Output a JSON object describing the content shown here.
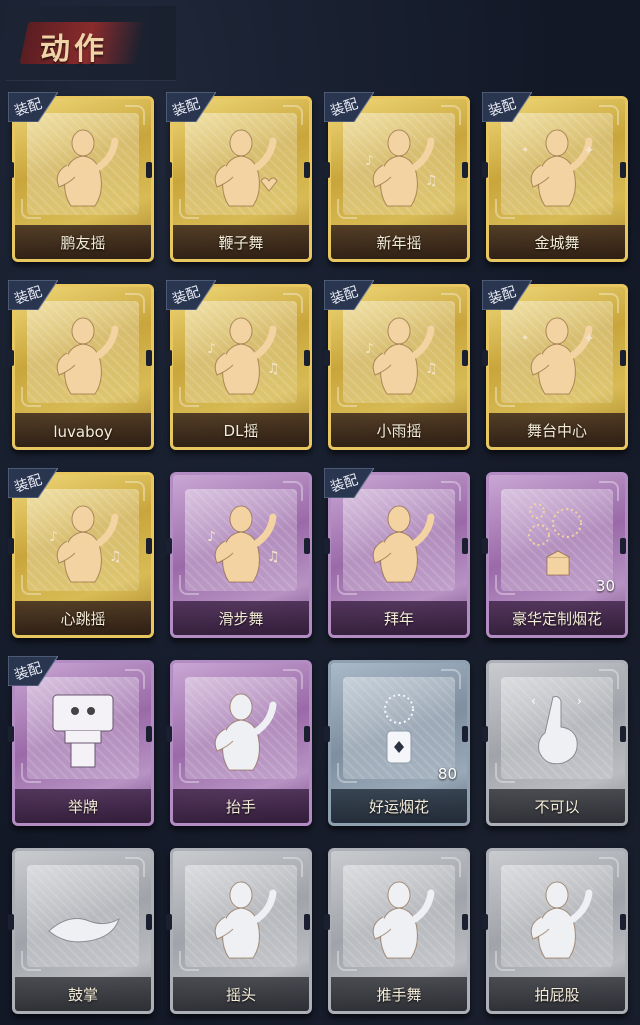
{
  "header": {
    "title": "动作"
  },
  "equip_label": "装配",
  "cards": [
    {
      "name": "鹏友摇",
      "style": "gold",
      "equipped": true,
      "icon": "dance-figure-icon"
    },
    {
      "name": "鞭子舞",
      "style": "gold",
      "equipped": true,
      "icon": "heart-dance-icon"
    },
    {
      "name": "新年摇",
      "style": "gold",
      "equipped": true,
      "icon": "music-dance-icon"
    },
    {
      "name": "金城舞",
      "style": "gold",
      "equipped": true,
      "icon": "wave-figure-icon"
    },
    {
      "name": "luvaboy",
      "style": "gold",
      "equipped": true,
      "icon": "dance-figure-icon"
    },
    {
      "name": "DL摇",
      "style": "gold",
      "equipped": true,
      "icon": "arm-raise-icon"
    },
    {
      "name": "小雨摇",
      "style": "gold",
      "equipped": true,
      "icon": "music-dance-icon"
    },
    {
      "name": "舞台中心",
      "style": "gold",
      "equipped": true,
      "icon": "sparkle-figure-icon"
    },
    {
      "name": "心跳摇",
      "style": "gold",
      "equipped": true,
      "icon": "heartbeat-dance-icon"
    },
    {
      "name": "滑步舞",
      "style": "purple",
      "equipped": false,
      "icon": "slide-dance-icon"
    },
    {
      "name": "拜年",
      "style": "purple",
      "equipped": true,
      "icon": "greeting-figure-icon"
    },
    {
      "name": "豪华定制烟花",
      "style": "purple",
      "equipped": false,
      "icon": "fireworks-box-icon",
      "count": "30"
    },
    {
      "name": "举牌",
      "style": "purple",
      "equipped": true,
      "icon": "sign-holding-icon"
    },
    {
      "name": "抬手",
      "style": "purple",
      "equipped": false,
      "icon": "raise-hand-icon"
    },
    {
      "name": "好运烟花",
      "style": "blue",
      "equipped": false,
      "icon": "firework-can-icon",
      "count": "80"
    },
    {
      "name": "不可以",
      "style": "gray",
      "equipped": false,
      "icon": "finger-no-icon"
    },
    {
      "name": "鼓掌",
      "style": "gray",
      "equipped": false,
      "icon": "clapping-hands-icon"
    },
    {
      "name": "摇头",
      "style": "gray",
      "equipped": false,
      "icon": "head-shake-icon"
    },
    {
      "name": "推手舞",
      "style": "gray",
      "equipped": false,
      "icon": "push-dance-icon"
    },
    {
      "name": "拍屁股",
      "style": "gray",
      "equipped": false,
      "icon": "butt-slap-icon"
    }
  ],
  "colors": {
    "gold": "#d8bb55",
    "purple": "#9a6aa8",
    "blue": "#7f8fa0",
    "gray": "#a0a3a9",
    "equip_badge": "#2a3550",
    "title_brush": "#8a2b2c",
    "title_text": "#f0d3a6"
  }
}
